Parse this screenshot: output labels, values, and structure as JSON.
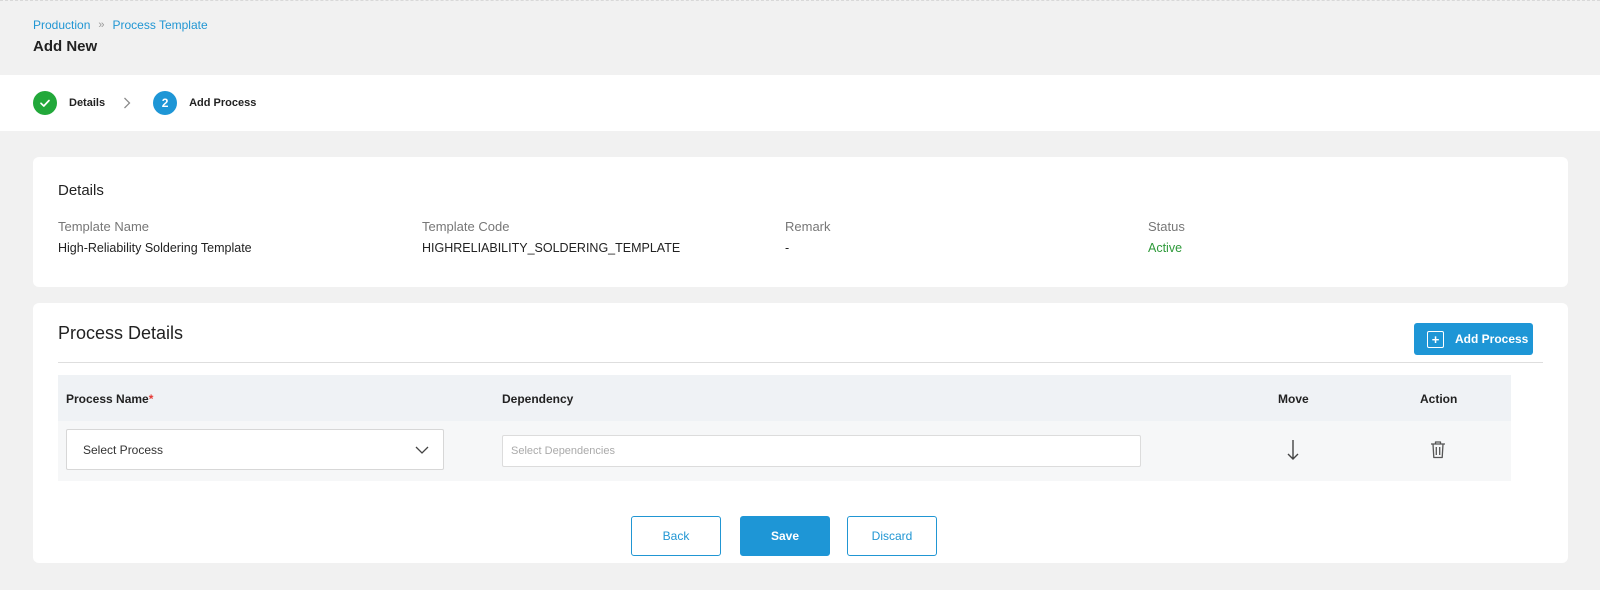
{
  "breadcrumb": {
    "items": [
      "Production",
      "Process Template"
    ],
    "separator": "»"
  },
  "page": {
    "title": "Add New"
  },
  "stepper": {
    "steps": [
      {
        "label": "Details",
        "state": "done"
      },
      {
        "label": "Add Process",
        "number": "2",
        "state": "active"
      }
    ]
  },
  "details": {
    "title": "Details",
    "fields": [
      {
        "label": "Template Name",
        "value": "High-Reliability Soldering Template"
      },
      {
        "label": "Template Code",
        "value": "HIGHRELIABILITY_SOLDERING_TEMPLATE"
      },
      {
        "label": "Remark",
        "value": "-"
      },
      {
        "label": "Status",
        "value": "Active"
      }
    ]
  },
  "process": {
    "title": "Process Details",
    "add_button": "Add Process",
    "columns": {
      "process_name": "Process Name",
      "required_mark": "*",
      "dependency": "Dependency",
      "move": "Move",
      "action": "Action"
    },
    "row": {
      "process_select": "Select Process",
      "dependency_placeholder": "Select Dependencies"
    }
  },
  "footer": {
    "back": "Back",
    "save": "Save",
    "discard": "Discard"
  },
  "colors": {
    "accent": "#1e96d6",
    "success": "#22a83a",
    "status_active": "#2e9a3a"
  }
}
